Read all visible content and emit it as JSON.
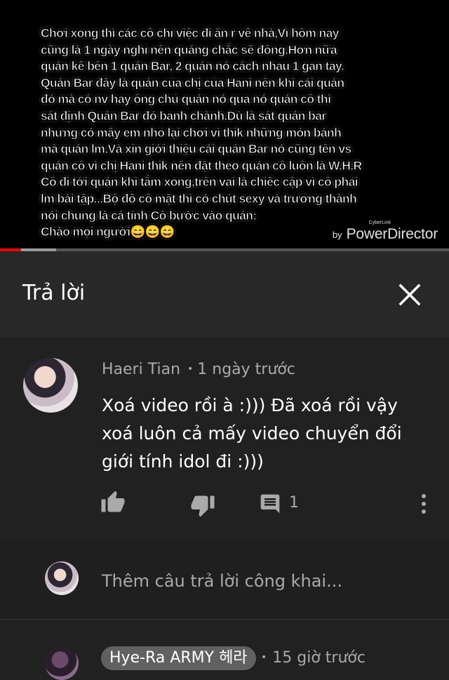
{
  "video": {
    "caption": " Chơi xong thì các cô chỉ việc đi ăn r về nhà,Vì hôm nay\ncũng là 1 ngày nghỉ nên quáng chắc sẽ đông.Hơn nữa\nquán kế bên 1 quán Bar, 2 quán nó cách nhau 1 gan tay.\nQuán Bar đấy là quán của chị của Hani nên khi cái quán\nđó mà có nv hay ông chủ quán nó qua nó quán cô thì\nsát định Quán Bar đó banh chành.Dù là sát quán bar\nnhưng có mấy em nhỏ lại chơi vì thik những món bánh\nmà quán lm.Và xin giới thiệu cái quán Bar nó cũng tên vs\nquán cô vì chị Hani thik nên đặt theo quán cô luôn là W.H.R\n Cô đi tới quán khi tắm xong,trên vai là chiếc cập vì cô phải\nlm bài tập...Bộ đồ cô mặt thì có chút sexy và trưởng thành\nnói chung là cá tính Cô bước vào quán:\nChào mọi người😄😄😄",
    "watermark_by": "by",
    "watermark_small": "CyberLink",
    "watermark_brand": "PowerDirector",
    "progress_played_fraction": 0.047,
    "progress_buffered_fraction": 0.125
  },
  "reply_panel": {
    "title": "Trả lời",
    "close_icon": "close-icon"
  },
  "comment": {
    "author": "Haeri Tian",
    "time": "1 ngày trước",
    "text": "Xoá video rồi à :))) Đã xoá rồi vậy xoá luôn cả mấy video chuyển đổi giới tính idol đi :)))",
    "reply_count": "1",
    "icons": [
      "thumb-up-icon",
      "thumb-down-icon",
      "comment-icon",
      "more-vert-icon"
    ]
  },
  "add_reply": {
    "placeholder": "Thêm câu trả lời công khai..."
  },
  "reply2": {
    "author": "Hye-Ra ARMY 헤라",
    "time": "15 giờ trước"
  },
  "colors": {
    "background": "#212121",
    "header_bg": "#282828",
    "secondary_text": "#aaaaaa",
    "progress_red": "#ff0000",
    "author_pill": "#616161"
  }
}
